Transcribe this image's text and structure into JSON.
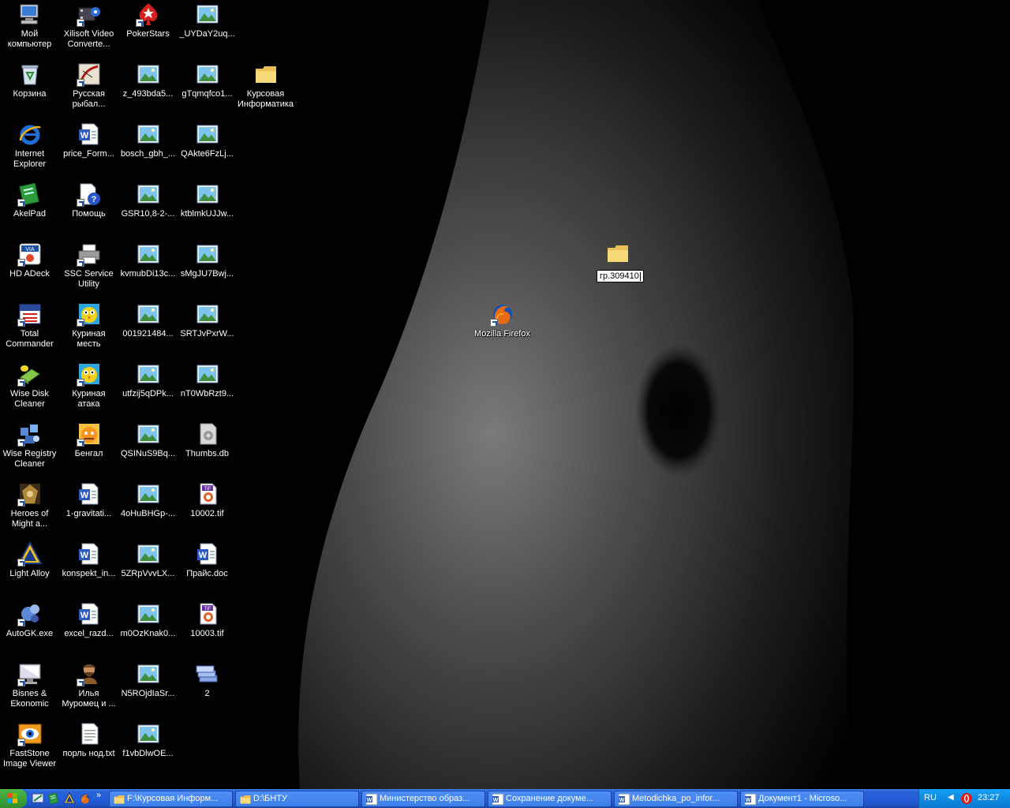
{
  "desktop": {
    "icons": [
      {
        "label": "Мой\nкомпьютер",
        "icon": "my-computer-icon"
      },
      {
        "label": "Xilisoft Video\nConverte...",
        "icon": "video-converter-icon"
      },
      {
        "label": "PokerStars",
        "icon": "pokerstars-icon"
      },
      {
        "label": "_UYDaY2uq...",
        "icon": "image-file-icon"
      },
      {
        "label": "Корзина",
        "icon": "recycle-bin-icon"
      },
      {
        "label": "Русская\nрыбал...",
        "icon": "fishing-game-icon"
      },
      {
        "label": "z_493bda5...",
        "icon": "image-file-icon"
      },
      {
        "label": "gTqmqfco1...",
        "icon": "image-file-icon"
      },
      {
        "label": "Курсовая\nИнформатика",
        "icon": "folder-icon"
      },
      {
        "label": "Internet\nExplorer",
        "icon": "internet-explorer-icon"
      },
      {
        "label": "price_Form...",
        "icon": "word-document-icon"
      },
      {
        "label": "bosch_gbh_...",
        "icon": "image-file-icon"
      },
      {
        "label": "QAkte6FzLj...",
        "icon": "image-file-icon"
      },
      {
        "label": "AkelPad",
        "icon": "akelpad-icon"
      },
      {
        "label": "Помощь",
        "icon": "help-document-icon"
      },
      {
        "label": "GSR10,8-2-...",
        "icon": "image-file-icon"
      },
      {
        "label": "ktblmkUJJw...",
        "icon": "image-file-icon"
      },
      {
        "label": "HD ADeck",
        "icon": "hd-adeck-icon"
      },
      {
        "label": "SSC Service\nUtility",
        "icon": "printer-icon"
      },
      {
        "label": "kvmubDi13c...",
        "icon": "image-file-icon"
      },
      {
        "label": "sMgJU7Bwj...",
        "icon": "image-file-icon"
      },
      {
        "label": "Total\nCommander",
        "icon": "total-commander-icon"
      },
      {
        "label": "Куриная\nместь",
        "icon": "chicken-game-icon"
      },
      {
        "label": "001921484...",
        "icon": "image-file-icon"
      },
      {
        "label": "SRTJvPxrW...",
        "icon": "image-file-icon"
      },
      {
        "label": "Mozilla Firefox",
        "icon": "firefox-icon"
      },
      {
        "label": "Wise Disk\nCleaner",
        "icon": "wise-disk-cleaner-icon"
      },
      {
        "label": "Куриная\nатака",
        "icon": "chicken-game-icon"
      },
      {
        "label": "utfzij5qDPk...",
        "icon": "image-file-icon"
      },
      {
        "label": "nT0WbRzt9...",
        "icon": "image-file-icon"
      },
      {
        "label": "Wise Registry\nCleaner",
        "icon": "wise-registry-icon"
      },
      {
        "label": "Бенгал",
        "icon": "bengal-game-icon"
      },
      {
        "label": "QSINuS9Bq...",
        "icon": "image-file-icon"
      },
      {
        "label": "Thumbs.db",
        "icon": "system-file-icon"
      },
      {
        "label": "Heroes of\nMight a...",
        "icon": "heroes-game-icon"
      },
      {
        "label": "1-gravitati...",
        "icon": "word-document-icon"
      },
      {
        "label": "4oHuBHGp-...",
        "icon": "image-file-icon"
      },
      {
        "label": "10002.tif",
        "icon": "tif-file-icon"
      },
      {
        "label": "Light Alloy",
        "icon": "light-alloy-icon"
      },
      {
        "label": "konspekt_in...",
        "icon": "word-document-icon"
      },
      {
        "label": "5ZRpVvvLX...",
        "icon": "image-file-icon"
      },
      {
        "label": "Прайс.doc",
        "icon": "word-document-icon"
      },
      {
        "label": "AutoGK.exe",
        "icon": "autogk-icon"
      },
      {
        "label": "excel_razd...",
        "icon": "word-document-icon"
      },
      {
        "label": "m0OzKnak0...",
        "icon": "image-file-icon"
      },
      {
        "label": "10003.tif",
        "icon": "tif-file-icon"
      },
      {
        "label": "Bisnes &\nEkonomic",
        "icon": "monitor-icon"
      },
      {
        "label": "Илья\nМуромец и ...",
        "icon": "ilya-muromets-icon"
      },
      {
        "label": "N5ROjdIaSr...",
        "icon": "image-file-icon"
      },
      {
        "label": "2",
        "icon": "stack-icon"
      },
      {
        "label": "FastStone\nImage Viewer",
        "icon": "faststone-icon"
      },
      {
        "label": "порль нод.txt",
        "icon": "text-file-icon"
      },
      {
        "label": "f1vbDlwOE...",
        "icon": "image-file-icon"
      }
    ],
    "rename_folder": {
      "value": "гр.309410",
      "icon": "folder-icon"
    }
  },
  "taskbar": {
    "start_icon": "windows-flag-icon",
    "quick_launch": [
      {
        "icon": "show-desktop-icon"
      },
      {
        "icon": "akelpad-icon"
      },
      {
        "icon": "light-alloy-icon"
      },
      {
        "icon": "firefox-icon"
      }
    ],
    "more": "»",
    "buttons": [
      {
        "label": "F:\\Курсовая Информ...",
        "icon": "folder-icon"
      },
      {
        "label": "D:\\БНТУ",
        "icon": "folder-icon"
      },
      {
        "label": "Министерство образ...",
        "icon": "word-icon"
      },
      {
        "label": "Сохранение докуме...",
        "icon": "word-icon"
      },
      {
        "label": "Metodichka_po_infor...",
        "icon": "word-icon"
      },
      {
        "label": "Документ1 - Microso...",
        "icon": "word-icon"
      }
    ],
    "tray": {
      "lang": "RU",
      "arrow": "◀",
      "clock": "23:27",
      "icon": "opera-icon"
    }
  }
}
